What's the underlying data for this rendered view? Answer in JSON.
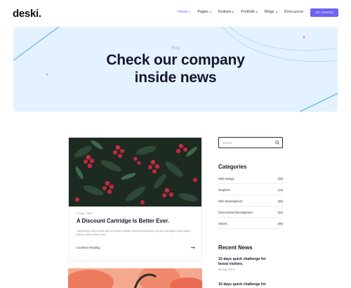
{
  "brand": {
    "logo": "deski."
  },
  "nav": {
    "items": [
      {
        "label": "Home",
        "active": true
      },
      {
        "label": "Pages",
        "active": false
      },
      {
        "label": "Feature",
        "active": false
      },
      {
        "label": "Portfolio",
        "active": false
      },
      {
        "label": "Blogs",
        "active": false
      },
      {
        "label": "Docs",
        "active": false
      }
    ],
    "login_label": "LOGIN",
    "cta_label": "GET STARTED"
  },
  "hero": {
    "eyebrow": "Blog",
    "title_line1": "Check our company",
    "title_line2": "inside news"
  },
  "post": {
    "date": "23 Apr, 2020",
    "title": "A Discount Cartridge Is Better Ever.",
    "excerpt": "Tomfoolery cillum fickle bits and bobs brilliant bamboozled down the pub amongst brolly hanky panky, cack bored chap.",
    "link_label": "Continue Reading"
  },
  "sidebar": {
    "search": {
      "placeholder": "Search"
    },
    "categories_heading": "Categories",
    "categories": [
      {
        "name": "Web Design",
        "count": "(09)"
      },
      {
        "name": "Graphics",
        "count": "(13)"
      },
      {
        "name": "Web Development",
        "count": "(05)"
      },
      {
        "name": "IOS/Android Development",
        "count": "(24)"
      },
      {
        "name": "Others",
        "count": "(09)"
      }
    ],
    "recent_heading": "Recent News",
    "recent": [
      {
        "title_line1": "10 days quick challenge for",
        "title_line2": "boost visitors.",
        "date": "05 July, 2019"
      },
      {
        "title_line1": "10 days quick challenge for",
        "title_line2": "",
        "date": ""
      }
    ]
  },
  "colors": {
    "accent": "#6d64f1",
    "hero_bg": "#e4f2ff",
    "heading": "#17172b",
    "muted": "#8a8a9a"
  },
  "icons": {
    "search": "search-icon",
    "chevron": "chevron-down-icon",
    "arrow": "arrow-right-icon"
  }
}
